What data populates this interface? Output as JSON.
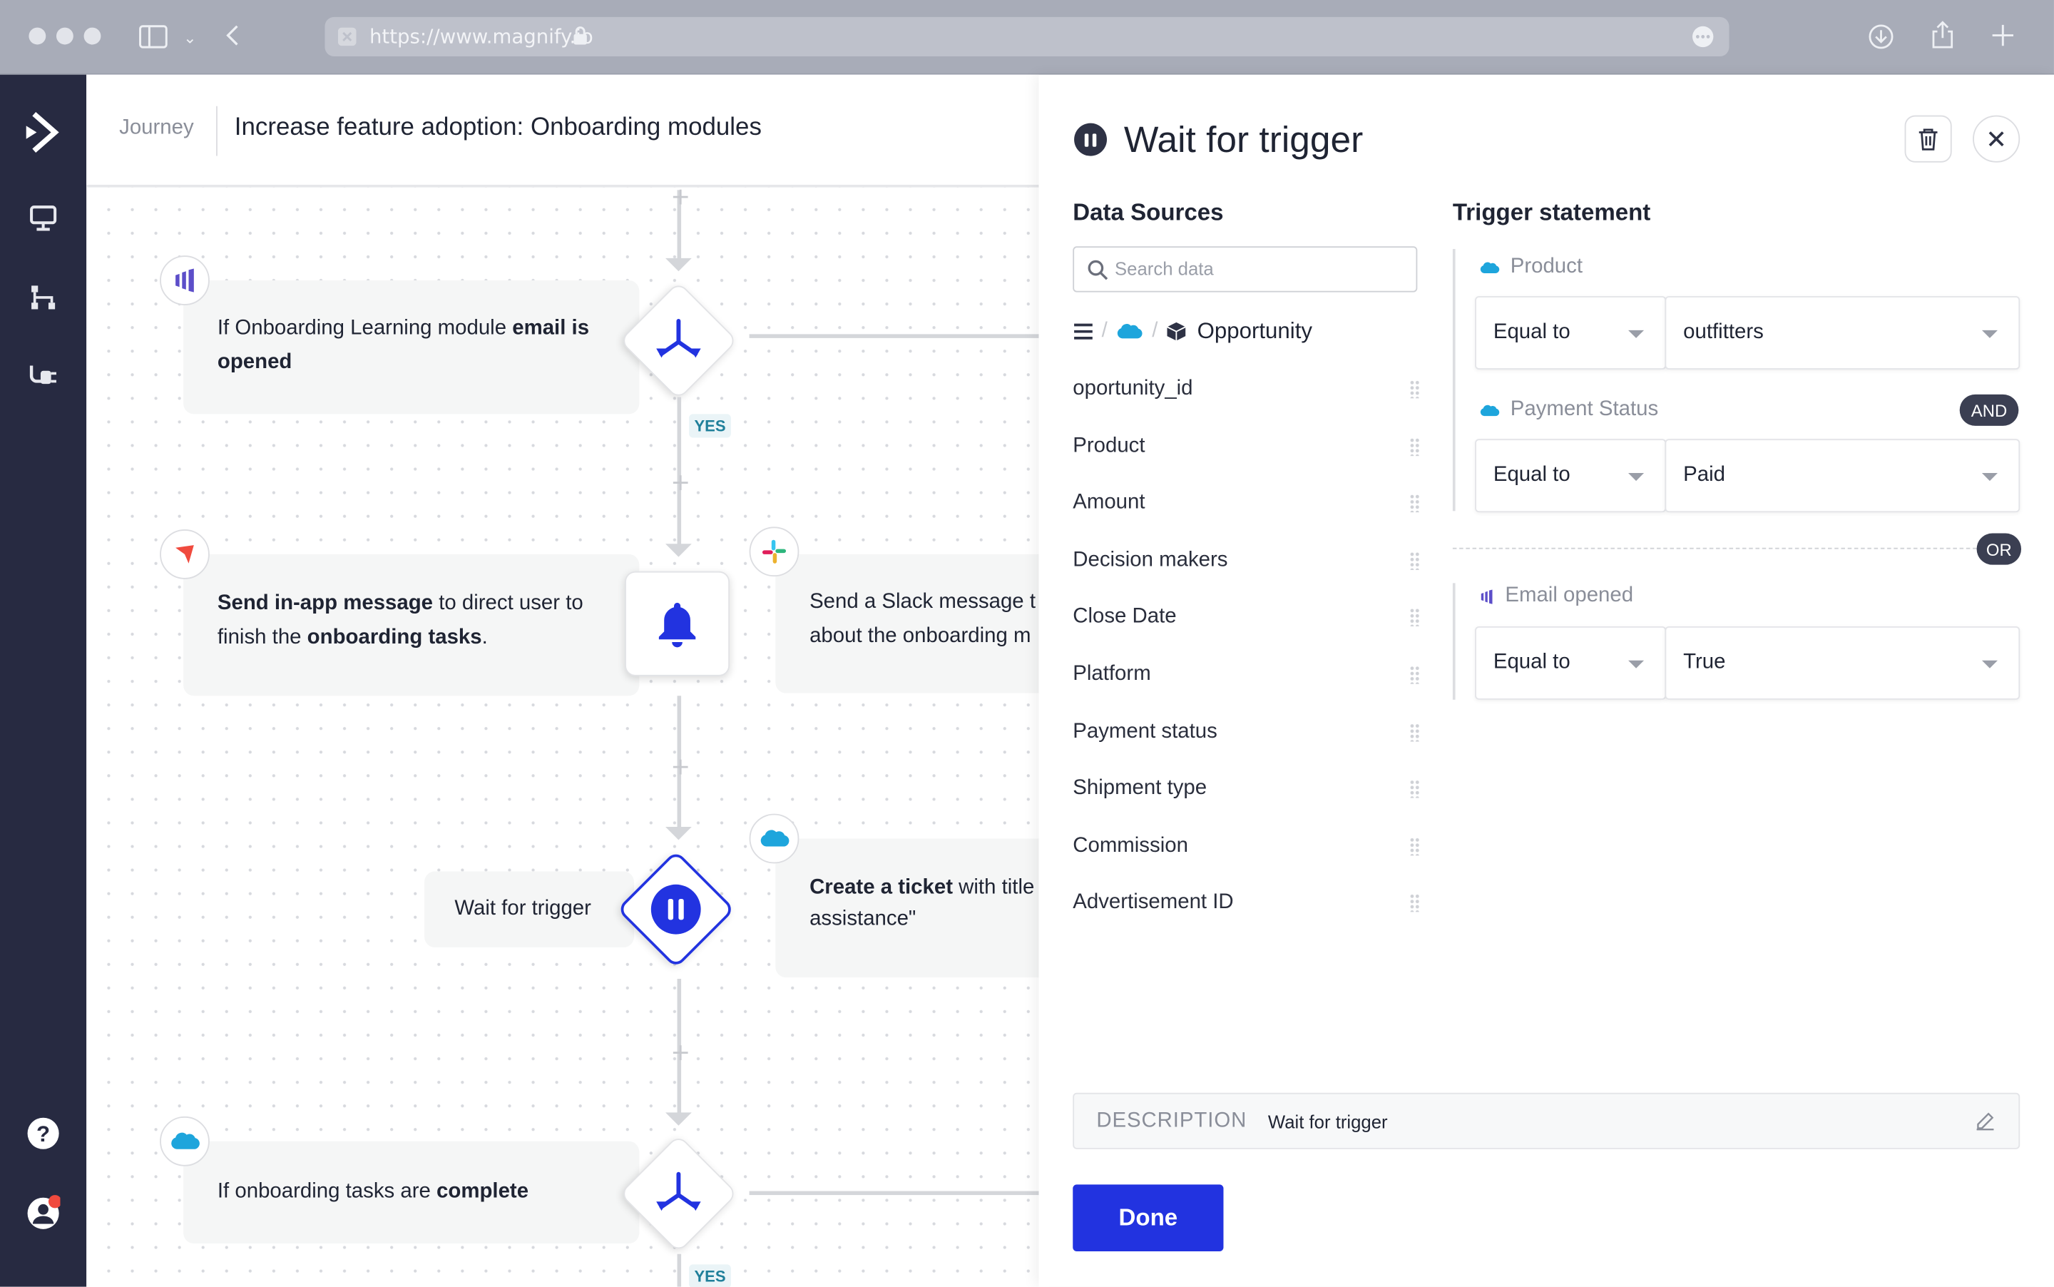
{
  "browser": {
    "url": "https://www.magnify.io"
  },
  "journey": {
    "breadcrumb": "Journey",
    "title": "Increase feature adoption: Onboarding modules",
    "yes_label": "YES",
    "nodes": {
      "email_condition": {
        "pre": "If Onboarding Learning module ",
        "bold": "email is",
        "line2_bold": "opened"
      },
      "inapp": {
        "bold1": "Send in-app message",
        "text1": " to direct user to",
        "text2": "finish the ",
        "bold2": "onboarding tasks",
        "text3": "."
      },
      "slack": {
        "line1": "Send a Slack message t",
        "line2": "about the onboarding m"
      },
      "wait": {
        "label": "Wait for trigger"
      },
      "ticket": {
        "bold": "Create a ticket",
        "text1": " with title",
        "line2": "assistance\""
      },
      "complete": {
        "pre": "If onboarding tasks are ",
        "bold": "complete"
      }
    }
  },
  "panel": {
    "title": "Wait for trigger",
    "data_sources_heading": "Data Sources",
    "search_placeholder": "Search data",
    "source_path": "Opportunity",
    "fields": [
      "oportunity_id",
      "Product",
      "Amount",
      "Decision makers",
      "Close Date",
      "Platform",
      "Payment status",
      "Shipment type",
      "Commission",
      "Advertisement ID"
    ],
    "trigger_heading": "Trigger statement",
    "conditions": [
      {
        "label": "Product",
        "operator": "Equal to",
        "value": "outfitters"
      },
      {
        "label": "Payment Status",
        "operator": "Equal to",
        "value": "Paid"
      },
      {
        "label": "Email opened",
        "operator": "Equal to",
        "value": "True"
      }
    ],
    "and_label": "AND",
    "or_label": "OR",
    "description_key": "DESCRIPTION",
    "description_value": "Wait for trigger",
    "done_label": "Done"
  },
  "colors": {
    "accent": "#2233e0",
    "sidebar": "#272a41",
    "salesforce": "#1ea5dc"
  }
}
